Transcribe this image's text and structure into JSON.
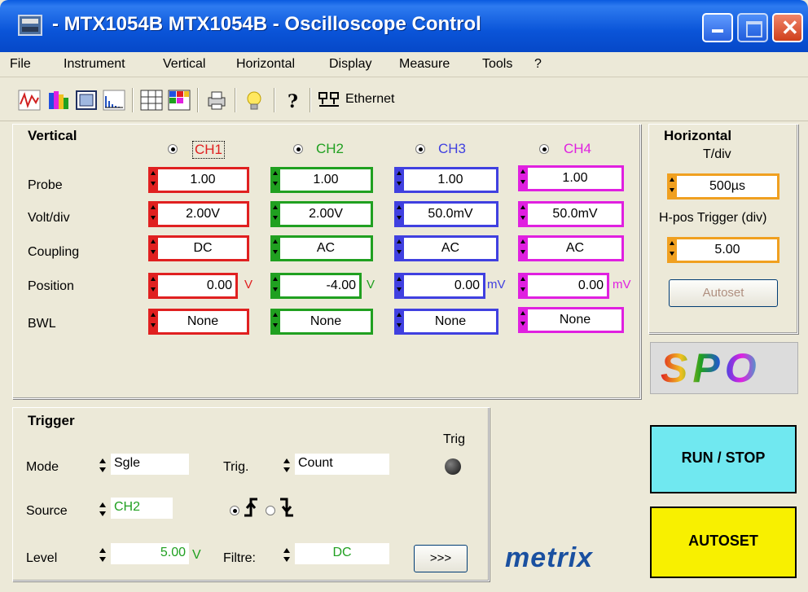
{
  "window": {
    "title": "- MTX1054B MTX1054B - Oscilloscope Control"
  },
  "menu": [
    "File",
    "Instrument",
    "Vertical",
    "Horizontal",
    "Display",
    "Measure",
    "Tools",
    "?"
  ],
  "toolbar": {
    "ethernet_label": "Ethernet"
  },
  "vertical": {
    "title": "Vertical",
    "row_labels": [
      "Probe",
      "Volt/div",
      "Coupling",
      "Position",
      "BWL"
    ],
    "channels": [
      {
        "name": "CH1",
        "color": "#e02020",
        "probe": "1.00",
        "volt_div": "2.00V",
        "coupling": "DC",
        "position": "0.00",
        "position_unit": "V",
        "bwl": "None"
      },
      {
        "name": "CH2",
        "color": "#20a020",
        "probe": "1.00",
        "volt_div": "2.00V",
        "coupling": "AC",
        "position": "-4.00",
        "position_unit": "V",
        "bwl": "None"
      },
      {
        "name": "CH3",
        "color": "#4040e0",
        "probe": "1.00",
        "volt_div": "50.0mV",
        "coupling": "AC",
        "position": "0.00",
        "position_unit": "mV",
        "bwl": "None"
      },
      {
        "name": "CH4",
        "color": "#e020e0",
        "probe": "1.00",
        "volt_div": "50.0mV",
        "coupling": "AC",
        "position": "0.00",
        "position_unit": "mV",
        "bwl": "None"
      }
    ]
  },
  "horizontal": {
    "title": "Horizontal",
    "tdiv_label": "T/div",
    "tdiv_value": "500µs",
    "hpos_label": "H-pos Trigger (div)",
    "hpos_value": "5.00",
    "autoset_label": "Autoset",
    "accent": "#f0a020"
  },
  "logo_spo": "SPO",
  "trigger": {
    "title": "Trigger",
    "mode_label": "Mode",
    "mode_value": "Sgle",
    "trig_label": "Trig.",
    "trig_value": "Count",
    "source_label": "Source",
    "source_value": "CH2",
    "level_label": "Level",
    "level_value": "5.00",
    "level_unit": "V",
    "filtre_label": "Filtre:",
    "filtre_value": "DC",
    "indicator_label": "Trig",
    "more_label": ">>>"
  },
  "run_stop_label": "RUN / STOP",
  "autoset_big_label": "AUTOSET",
  "brand": "metrix"
}
